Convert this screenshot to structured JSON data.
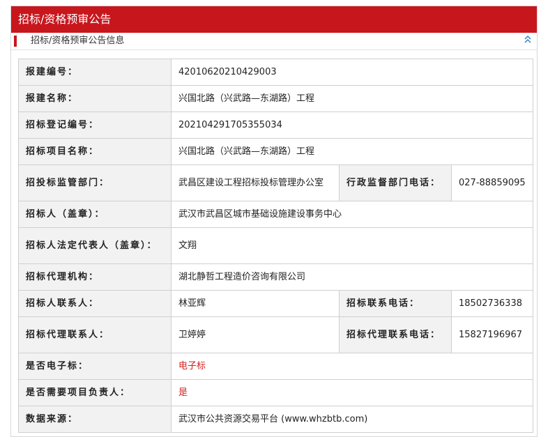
{
  "header": {
    "title": "招标/资格预审公告"
  },
  "section": {
    "title": "招标/资格预审公告信息",
    "collapse_icon": "double-chevron-up-icon"
  },
  "rows": {
    "build_no": {
      "label": "报建编号：",
      "value": "42010620210429003"
    },
    "build_name": {
      "label": "报建名称：",
      "value": "兴国北路（兴武路—东湖路）工程"
    },
    "reg_no": {
      "label": "招标登记编号：",
      "value": "20210429170535503​4"
    },
    "project_name": {
      "label": "招标项目名称：",
      "value": "兴国北路（兴武路—东湖路）工程"
    },
    "supervisor": {
      "label": "招投标监管部门：",
      "value": "武昌区建设工程招标投标管理办公室",
      "phone_label": "行政监督部门电话：",
      "phone": "027-88859095"
    },
    "tenderer": {
      "label": "招标人（盖章）：",
      "value": "武汉市武昌区城市基础设施建设事务中心"
    },
    "legal_rep": {
      "label": "招标人法定代表人（盖章）：",
      "value": "文翔"
    },
    "agency": {
      "label": "招标代理机构：",
      "value": "湖北静哲工程造价咨询有限公司"
    },
    "contact": {
      "label": "招标人联系人：",
      "value": "林亚辉",
      "phone_label": "招标联系电话：",
      "phone": "18502736338"
    },
    "agency_contact": {
      "label": "招标代理联系人：",
      "value": "卫婷婷",
      "phone_label": "招标代理联系电话：",
      "phone": "15827196967"
    },
    "electronic": {
      "label": "是否电子标：",
      "value": "电子标"
    },
    "need_manager": {
      "label": "是否需要项目负责人：",
      "value": "是"
    },
    "source": {
      "label": "数据来源：",
      "value": "武汉市公共资源交易平台 (www.whzbtb.com)"
    }
  },
  "colors": {
    "accent": "#c8161d",
    "label_bg": "#f2f2f2",
    "highlight": "#d21f1f"
  }
}
